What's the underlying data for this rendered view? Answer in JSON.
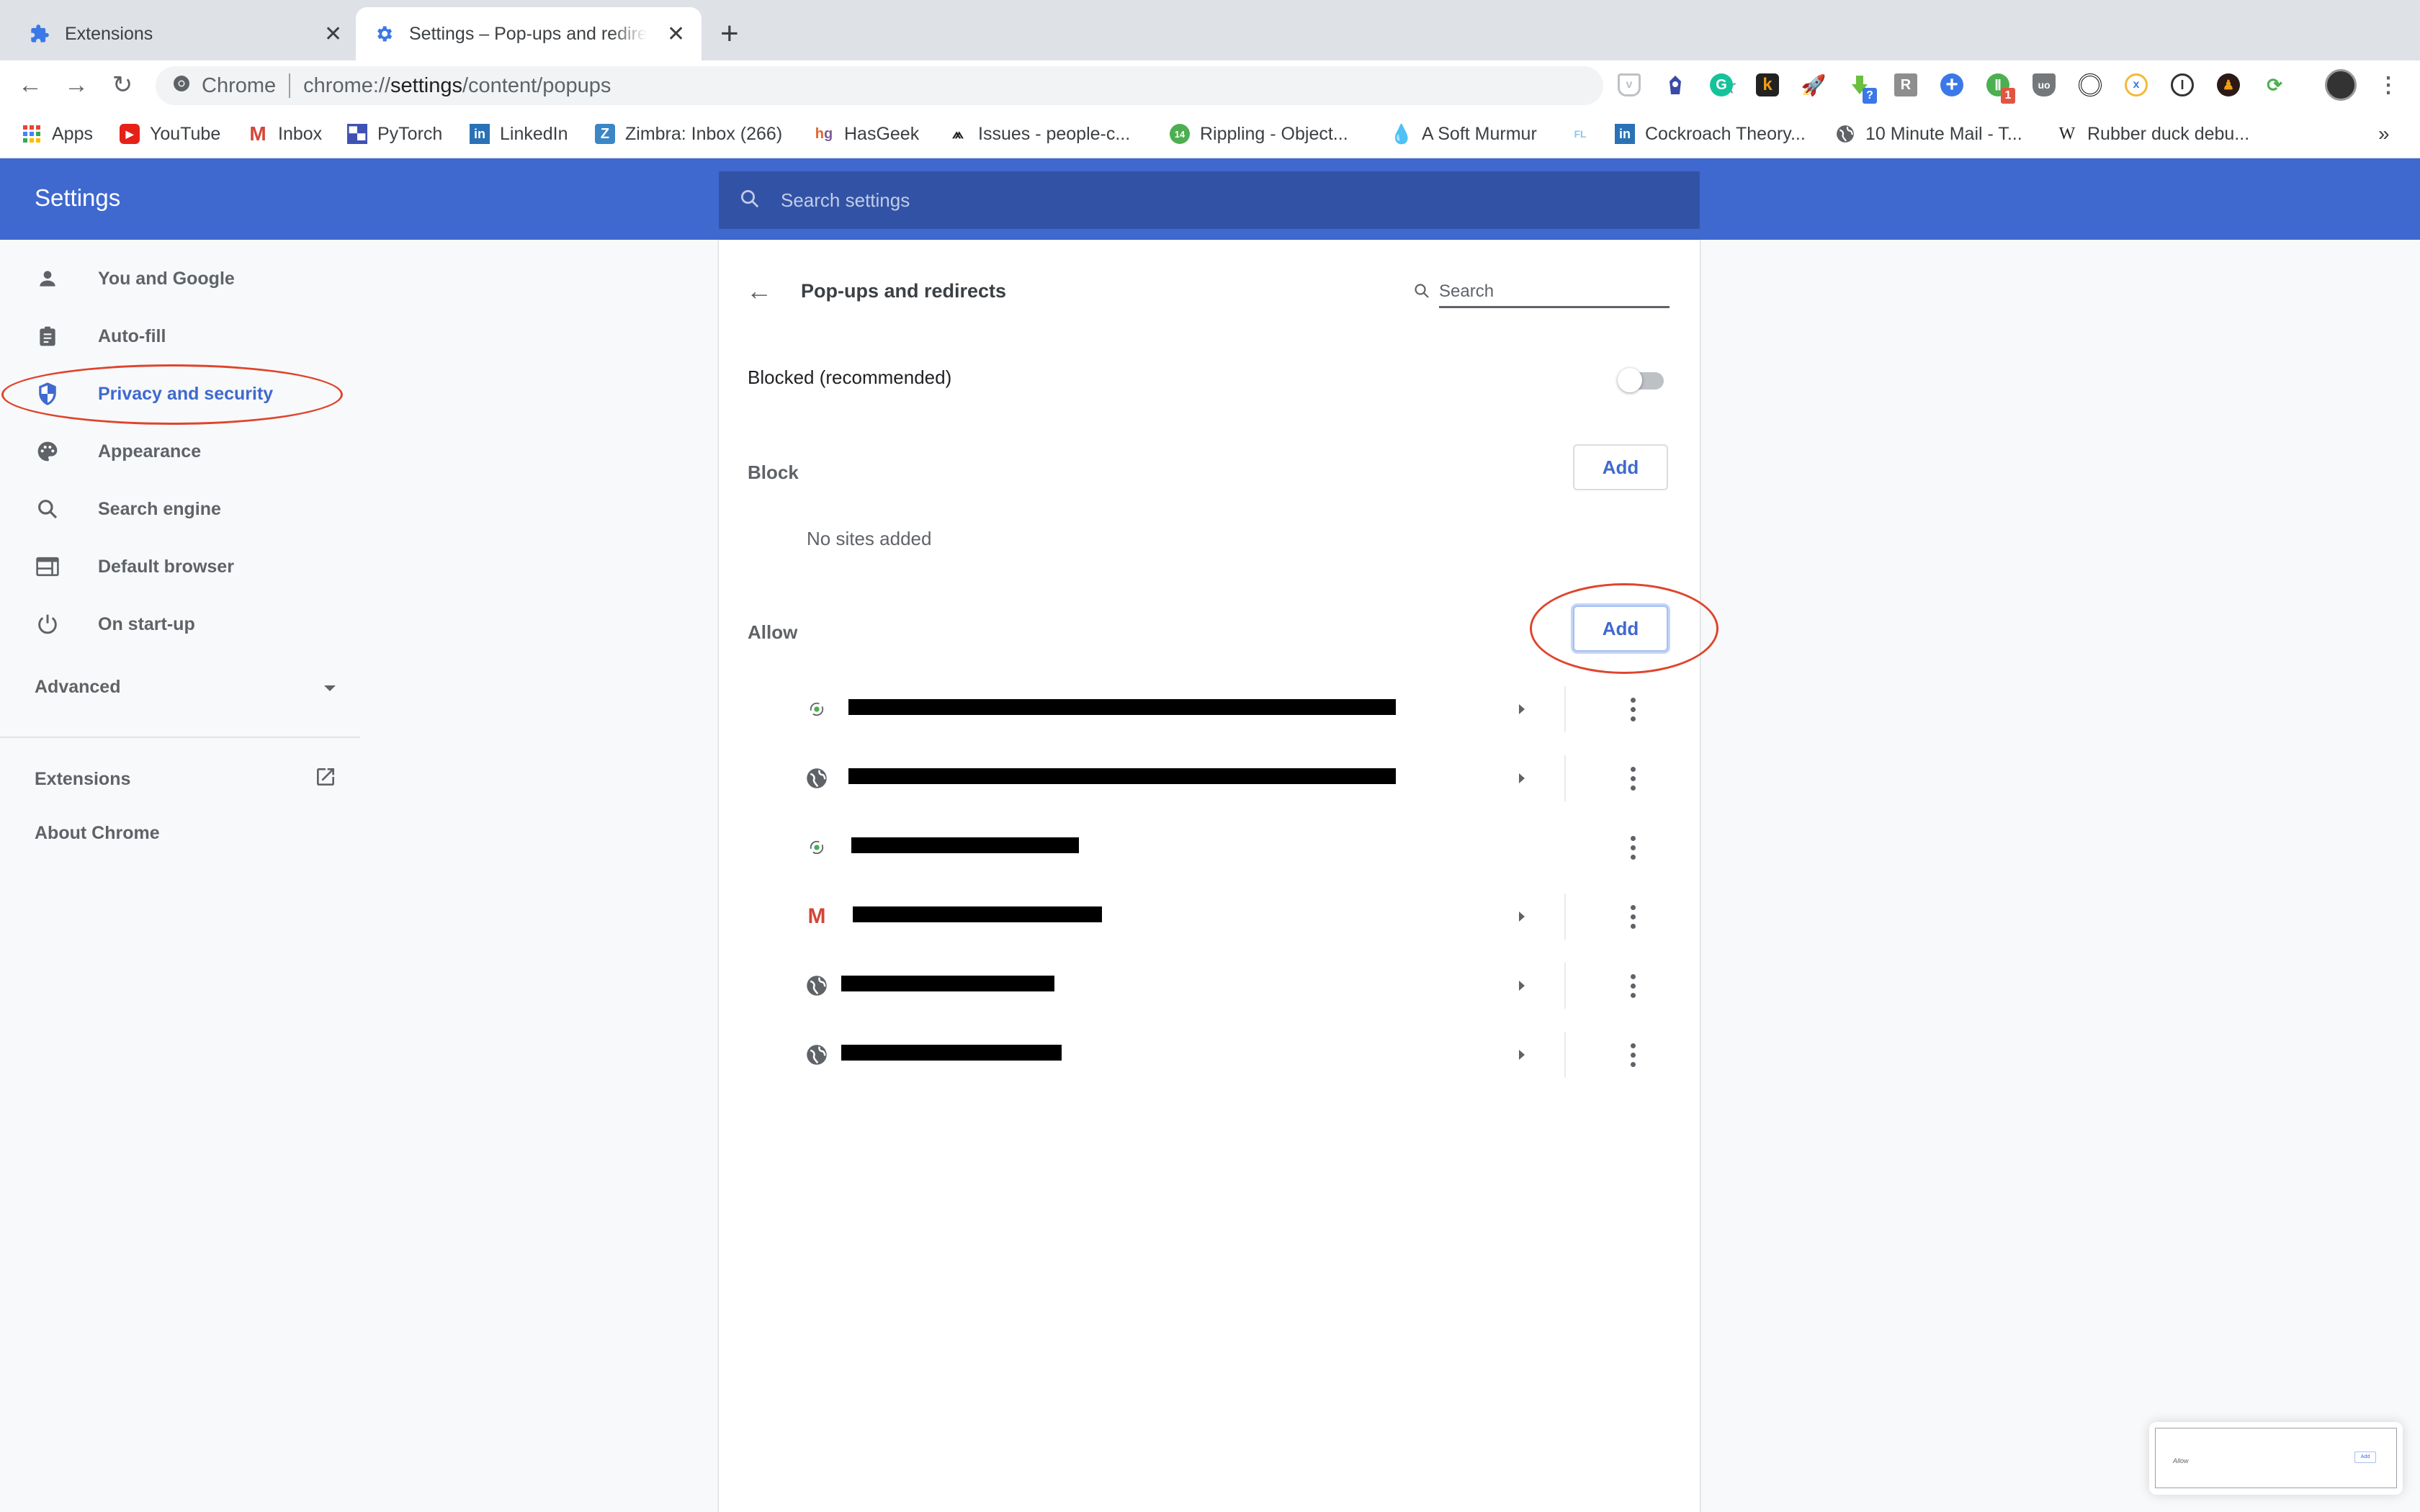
{
  "browser": {
    "tabs": [
      {
        "label": "Extensions",
        "icon": "puzzle-icon",
        "active": false
      },
      {
        "label": "Settings – Pop-ups and redirects",
        "icon": "gear-icon",
        "active": true
      }
    ],
    "new_tab_label": "+",
    "omnibox": {
      "site_label": "Chrome",
      "url_prefix": "chrome://",
      "url_host": "settings",
      "url_path": "/content/popups"
    },
    "extensions": [
      {
        "name": "pocket"
      },
      {
        "name": "iit-kgp"
      },
      {
        "name": "grammarly",
        "glyph": "G"
      },
      {
        "name": "k-extension",
        "glyph": "k"
      },
      {
        "name": "rocket"
      },
      {
        "name": "download",
        "badge": "?"
      },
      {
        "name": "r-extension",
        "glyph": "R"
      },
      {
        "name": "plus-extension",
        "glyph": "+"
      },
      {
        "name": "pushbullet",
        "badge": "1"
      },
      {
        "name": "ublock-origin"
      },
      {
        "name": "concentric"
      },
      {
        "name": "xdebug"
      },
      {
        "name": "1password"
      },
      {
        "name": "chess"
      },
      {
        "name": "whatsapp-sync"
      }
    ],
    "bookmarks": [
      {
        "label": "Apps",
        "icon": "apps-grid-icon"
      },
      {
        "label": "YouTube",
        "icon": "youtube-icon"
      },
      {
        "label": "Inbox",
        "icon": "gmail-icon"
      },
      {
        "label": "PyTorch",
        "icon": "pytorch-icon"
      },
      {
        "label": "LinkedIn",
        "icon": "linkedin-icon"
      },
      {
        "label": "Zimbra: Inbox (266)",
        "icon": "zimbra-icon"
      },
      {
        "label": "HasGeek",
        "icon": "hasgeek-icon"
      },
      {
        "label": "Issues - people-c...",
        "icon": "sentry-icon"
      },
      {
        "label": "Rippling - Object...",
        "icon": "rippling-icon",
        "badge": "14"
      },
      {
        "label": "A Soft Murmur",
        "icon": "droplet-icon"
      },
      {
        "label": "",
        "icon": "fl-icon",
        "glyph": "FL"
      },
      {
        "label": "Cockroach Theory...",
        "icon": "linkedin-icon"
      },
      {
        "label": "10 Minute Mail - T...",
        "icon": "globe-icon"
      },
      {
        "label": "Rubber duck debu...",
        "icon": "wikipedia-icon",
        "glyph": "W"
      }
    ],
    "bookmarks_overflow": "»"
  },
  "settings": {
    "title": "Settings",
    "search_placeholder": "Search settings",
    "sidebar": {
      "items": [
        {
          "label": "You and Google",
          "icon": "person-icon"
        },
        {
          "label": "Auto-fill",
          "icon": "clipboard-icon"
        },
        {
          "label": "Privacy and security",
          "icon": "shield-icon",
          "active": true
        },
        {
          "label": "Appearance",
          "icon": "palette-icon"
        },
        {
          "label": "Search engine",
          "icon": "search-icon"
        },
        {
          "label": "Default browser",
          "icon": "browser-icon"
        },
        {
          "label": "On start-up",
          "icon": "power-icon"
        }
      ],
      "advanced_label": "Advanced",
      "extensions_label": "Extensions",
      "about_label": "About Chrome"
    },
    "page": {
      "title": "Pop-ups and redirects",
      "search_placeholder": "Search",
      "blocked_label": "Blocked (recommended)",
      "blocked_enabled": false,
      "block_section": {
        "label": "Block",
        "add_label": "Add",
        "empty_text": "No sites added"
      },
      "allow_section": {
        "label": "Allow",
        "add_label": "Add",
        "sites": [
          {
            "favicon": "whatsapp-sync-icon",
            "text": "[redacted]",
            "expandable": true
          },
          {
            "favicon": "globe-icon",
            "text": "[redacted]",
            "expandable": true
          },
          {
            "favicon": "whatsapp-sync-icon",
            "text": "[redacted]",
            "expandable": false
          },
          {
            "favicon": "gmail-icon",
            "text": "[redacted]",
            "expandable": true
          },
          {
            "favicon": "globe-icon",
            "text": "[redacted]",
            "expandable": true
          },
          {
            "favicon": "globe-icon",
            "text": "[redacted]",
            "expandable": true
          }
        ]
      }
    }
  },
  "thumbnail_preview": {
    "label": "Allow",
    "button": "Add"
  },
  "colors": {
    "accent": "#3f69cf",
    "header": "#3f69cf",
    "search_bg": "#3253a5",
    "annotation": "#e0442c"
  }
}
